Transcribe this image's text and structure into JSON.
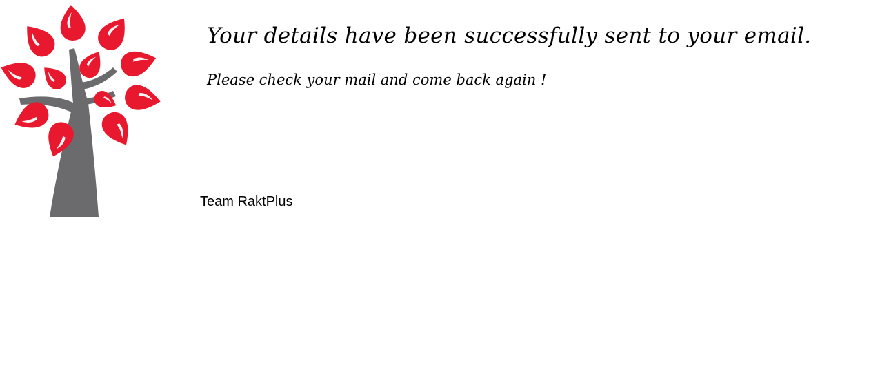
{
  "logo": {
    "icon": "tree-with-red-drop-leaves-icon",
    "leaf_color": "#e8192e",
    "trunk_color": "#6b6b6e"
  },
  "message": {
    "headline": "Your details have been successfully sent to your email.",
    "subline": "Please check your mail and come back again !"
  },
  "signature": {
    "text": "Team RaktPlus"
  }
}
